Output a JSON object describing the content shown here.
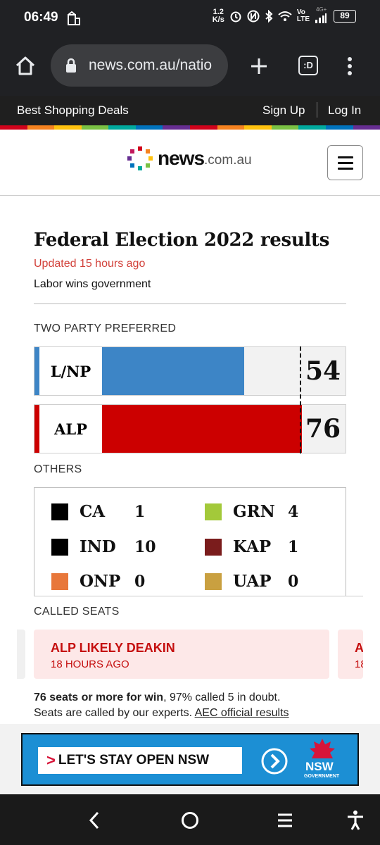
{
  "status_bar": {
    "time": "06:49",
    "net_speed_top": "1.2",
    "net_speed_bottom": "K/s",
    "volte": "Vo",
    "lte": "LTE",
    "signal_gen": "4G+",
    "battery": "89"
  },
  "browser": {
    "url": "news.com.au/natio",
    "tab_switcher_label": ":D"
  },
  "top_bar": {
    "shopping": "Best Shopping Deals",
    "signup": "Sign Up",
    "login": "Log In"
  },
  "brand": {
    "name_bold": "news",
    "name_suffix": ".com.au"
  },
  "stripe_colors": [
    "#d0021b",
    "#f5821f",
    "#ffc20e",
    "#7ac143",
    "#00a99d",
    "#0072bc",
    "#662d91",
    "#d0021b",
    "#f5821f",
    "#ffc20e",
    "#7ac143",
    "#00a99d",
    "#0072bc",
    "#662d91"
  ],
  "election": {
    "title": "Federal Election 2022 results",
    "updated": "Updated 15 hours ago",
    "summary": "Labor wins government",
    "tpp_label": "TWO PARTY PREFERRED",
    "majority_line_seats": 76,
    "bars": [
      {
        "party": "L/NP",
        "seats": "54",
        "seat_value": 54,
        "color": "#3d85c6"
      },
      {
        "party": "ALP",
        "seats": "76",
        "seat_value": 76,
        "color": "#cc0000"
      }
    ],
    "others_label": "OTHERS",
    "others": [
      {
        "party": "CA",
        "seats": "1",
        "color": "#000000"
      },
      {
        "party": "GRN",
        "seats": "4",
        "color": "#a3c93a"
      },
      {
        "party": "IND",
        "seats": "10",
        "color": "#000000"
      },
      {
        "party": "KAP",
        "seats": "1",
        "color": "#7a1c1c"
      },
      {
        "party": "ONP",
        "seats": "0",
        "color": "#e8773a"
      },
      {
        "party": "UAP",
        "seats": "0",
        "color": "#c9a040"
      }
    ],
    "called_seats_label": "CALLED SEATS",
    "called_seats": [
      {
        "title": "ALP LIKELY DEAKIN",
        "time": "18 HOURS AGO"
      },
      {
        "title": "A",
        "time": "18"
      }
    ],
    "footnote_bold": "76 seats or more for win",
    "footnote_rest": ", 97% called 5 in doubt.",
    "footnote_line2": "Seats are called by our experts. ",
    "footnote_link": "AEC official results"
  },
  "ad": {
    "headline": "LET'S STAY OPEN NSW",
    "org_line1": "NSW",
    "org_line2": "GOVERNMENT"
  }
}
